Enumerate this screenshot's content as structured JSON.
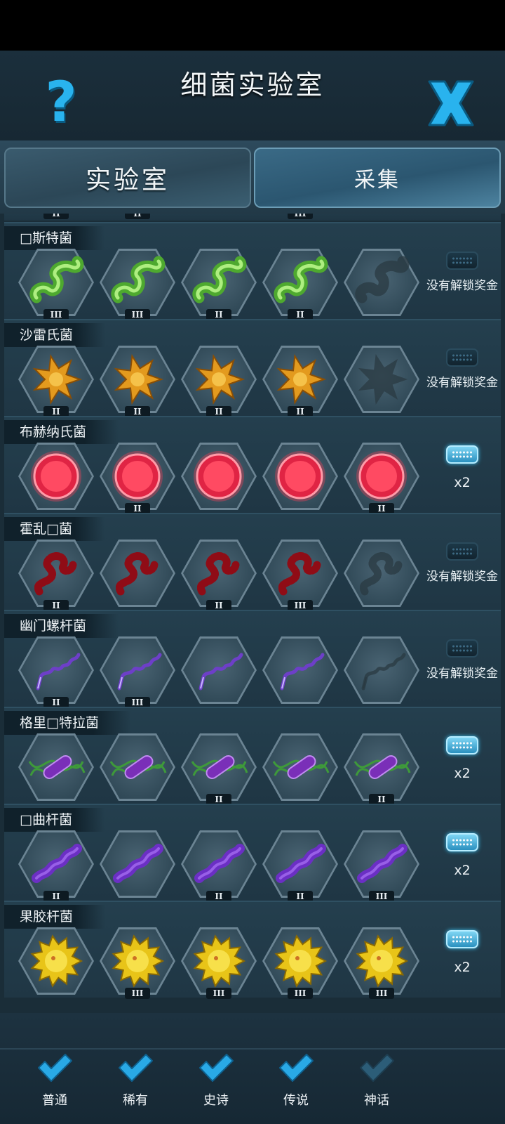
{
  "header": {
    "title": "细菌实验室",
    "help_icon": "question-mark-icon",
    "close_icon": "close-x-icon"
  },
  "tabs": [
    {
      "label": "实验室",
      "active": true
    },
    {
      "label": "采集",
      "active": false
    }
  ],
  "colors": {
    "accent": "#29b3ee",
    "check": "#29a9e6",
    "check_dim": "#2c5d78"
  },
  "top_partial_tiers": [
    "II",
    "II",
    "",
    "III",
    ""
  ],
  "rows": [
    {
      "name": "□斯特菌",
      "bug": "green-spiral",
      "tiers": [
        "III",
        "III",
        "II",
        "II",
        ""
      ],
      "collected": [
        true,
        true,
        true,
        true,
        false
      ],
      "reward": "没有解锁奖金",
      "unlocked": false
    },
    {
      "name": "沙雷氏菌",
      "bug": "orange-star",
      "tiers": [
        "II",
        "II",
        "II",
        "II",
        ""
      ],
      "collected": [
        true,
        true,
        true,
        true,
        false
      ],
      "reward": "没有解锁奖金",
      "unlocked": false
    },
    {
      "name": "布赫纳氏菌",
      "bug": "red-disc",
      "tiers": [
        "",
        "II",
        "",
        "",
        "II"
      ],
      "collected": [
        true,
        true,
        true,
        true,
        true
      ],
      "reward": "x2",
      "unlocked": true
    },
    {
      "name": "霍乱□菌",
      "bug": "red-chain",
      "tiers": [
        "II",
        "",
        "II",
        "III",
        ""
      ],
      "collected": [
        true,
        true,
        true,
        true,
        false
      ],
      "reward": "没有解锁奖金",
      "unlocked": false
    },
    {
      "name": "幽门螺杆菌",
      "bug": "purple-coil",
      "tiers": [
        "II",
        "III",
        "",
        "",
        ""
      ],
      "collected": [
        true,
        true,
        true,
        true,
        false
      ],
      "reward": "没有解锁奖金",
      "unlocked": false
    },
    {
      "name": "格里□特拉菌",
      "bug": "purple-rod",
      "tiers": [
        "",
        "",
        "II",
        "",
        "II"
      ],
      "collected": [
        true,
        true,
        true,
        true,
        true
      ],
      "reward": "x2",
      "unlocked": true
    },
    {
      "name": "□曲杆菌",
      "bug": "purple-chain",
      "tiers": [
        "II",
        "",
        "II",
        "II",
        "III"
      ],
      "collected": [
        true,
        true,
        true,
        true,
        true
      ],
      "reward": "x2",
      "unlocked": true
    },
    {
      "name": "果胶杆菌",
      "bug": "yellow-spiky",
      "tiers": [
        "",
        "III",
        "III",
        "III",
        "III"
      ],
      "collected": [
        true,
        true,
        true,
        true,
        true
      ],
      "reward": "x2",
      "unlocked": true
    }
  ],
  "filters": [
    {
      "label": "普通",
      "checked": true,
      "icon": "checkmark-icon"
    },
    {
      "label": "稀有",
      "checked": true,
      "icon": "checkmark-icon"
    },
    {
      "label": "史诗",
      "checked": true,
      "icon": "checkmark-icon"
    },
    {
      "label": "传说",
      "checked": true,
      "icon": "checkmark-icon"
    },
    {
      "label": "神话",
      "checked": false,
      "icon": "checkmark-icon"
    }
  ]
}
